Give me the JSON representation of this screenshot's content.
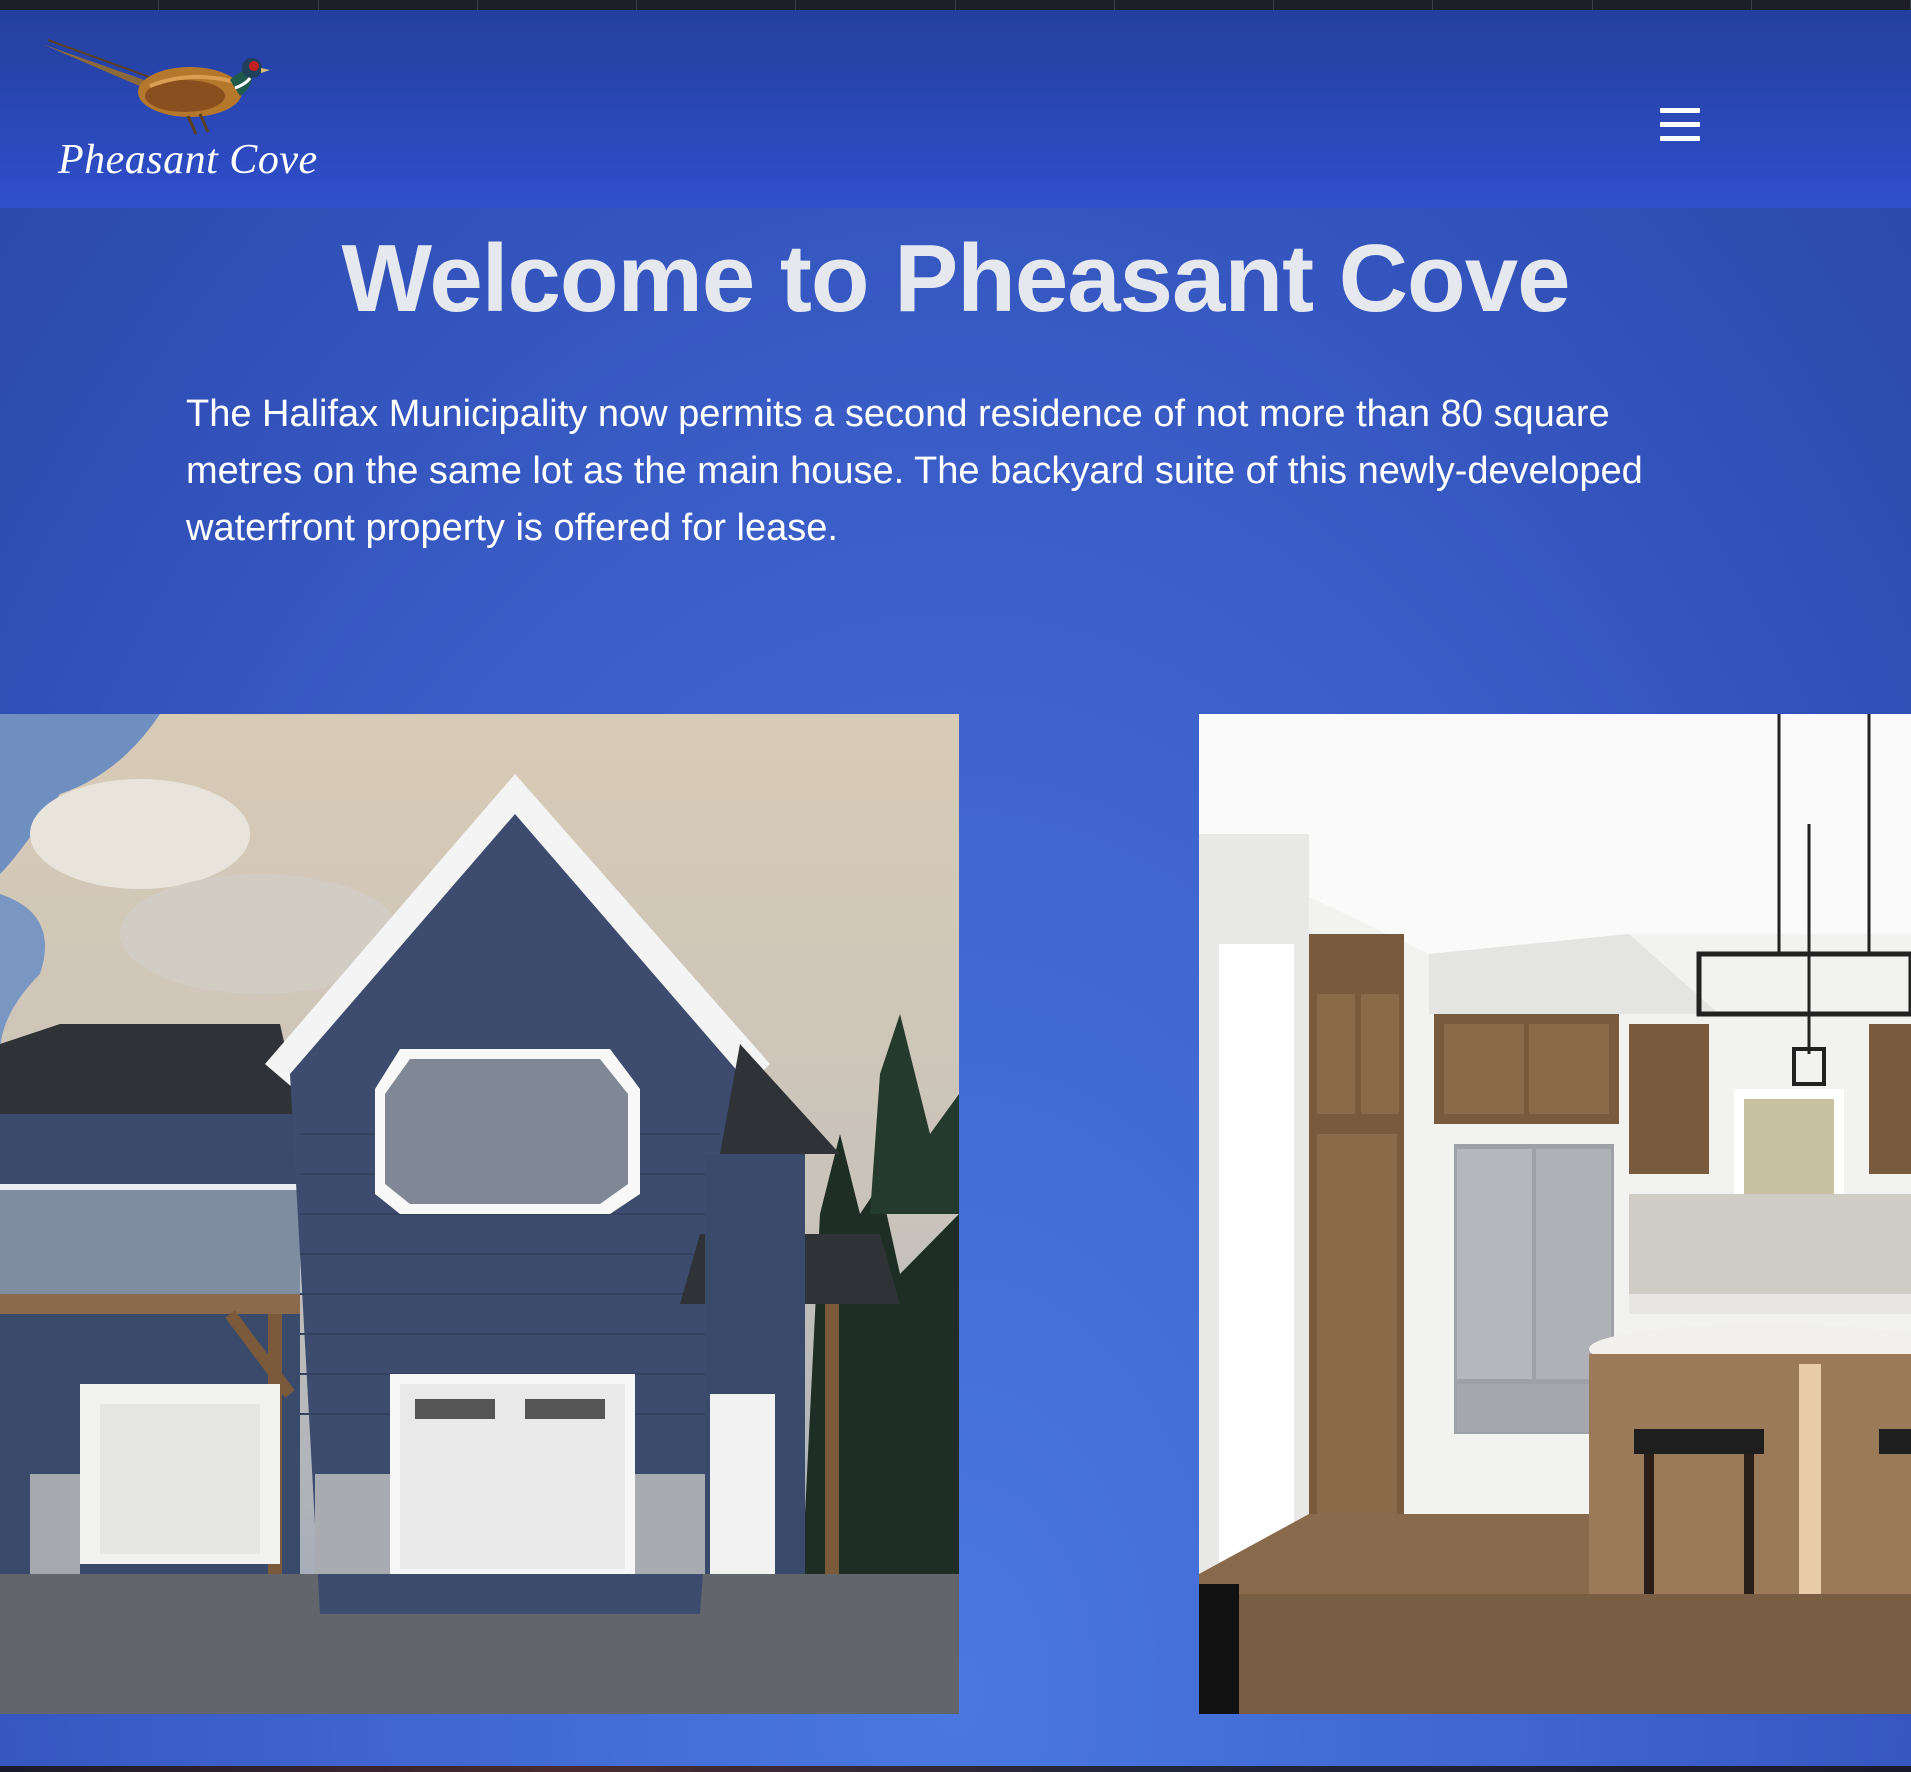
{
  "header": {
    "logo_text": "Pheasant Cove",
    "logo_icon": "pheasant-icon",
    "menu_icon": "hamburger-menu-icon"
  },
  "hero": {
    "title": "Welcome to Pheasant Cove",
    "intro": "The Halifax Municipality now permits a second residence of not more than 80 square metres on the same lot as the main house. The backyard suite of this newly-developed waterfront property is offered for lease."
  },
  "gallery": {
    "images": [
      {
        "icon": "house-exterior-photo"
      },
      {
        "icon": "kitchen-interior-photo"
      }
    ]
  },
  "colors": {
    "header_bg": "#2a45b8",
    "hero_bg": "#3f64cf",
    "title_text": "#e6e8ef",
    "body_text": "#ffffff"
  }
}
